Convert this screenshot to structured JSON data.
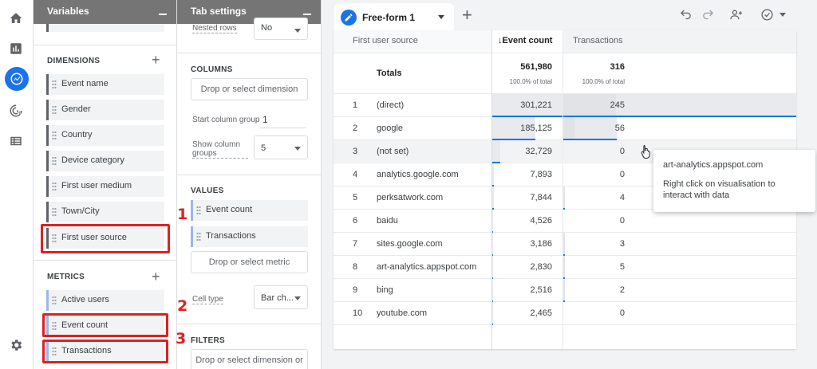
{
  "rail": {
    "icons": [
      "home-icon",
      "reports-icon",
      "explore-icon",
      "advertising-icon",
      "configure-icon",
      "settings-icon"
    ]
  },
  "variables": {
    "title": "Variables",
    "dimensions_label": "DIMENSIONS",
    "dimensions": [
      "Event name",
      "Gender",
      "Country",
      "Device category",
      "First user medium",
      "Town/City",
      "First user source"
    ],
    "metrics_label": "METRICS",
    "metrics": [
      "Active users",
      "Event count",
      "Transactions"
    ]
  },
  "tab_settings": {
    "title": "Tab settings",
    "nested_rows_label": "Nested rows",
    "nested_rows_value": "No",
    "columns_label": "COLUMNS",
    "columns_drop": "Drop or select dimension",
    "start_column_group_label": "Start column group",
    "start_column_group_value": "1",
    "show_column_groups_label": "Show column groups",
    "show_column_groups_value": "5",
    "values_label": "VALUES",
    "values": [
      "Event count",
      "Transactions"
    ],
    "values_drop": "Drop or select metric",
    "cell_type_label": "Cell type",
    "cell_type_value": "Bar ch...",
    "filters_label": "FILTERS",
    "filters_drop": "Drop or select dimension or"
  },
  "annotations": [
    "1",
    "2",
    "3"
  ],
  "tab": {
    "name": "Free-form 1",
    "add": "+"
  },
  "table": {
    "headers": {
      "dimension": "First user source",
      "event_count": "↓Event count",
      "transactions": "Transactions"
    },
    "totals": {
      "label": "Totals",
      "event_count": "561,980",
      "event_count_pct": "100.0% of total",
      "transactions": "316",
      "transactions_pct": "100.0% of total"
    },
    "rows": [
      {
        "n": "1",
        "source": "(direct)",
        "events": "301,221",
        "transactions": "245",
        "events_frac": 1.0,
        "trans_frac": 1.0
      },
      {
        "n": "2",
        "source": "google",
        "events": "185,125",
        "transactions": "56",
        "events_frac": 0.615,
        "trans_frac": 0.229
      },
      {
        "n": "3",
        "source": "(not set)",
        "events": "32,729",
        "transactions": "0",
        "events_frac": 0.109,
        "trans_frac": 0
      },
      {
        "n": "4",
        "source": "analytics.google.com",
        "events": "7,893",
        "transactions": "0",
        "events_frac": 0.026,
        "trans_frac": 0
      },
      {
        "n": "5",
        "source": "perksatwork.com",
        "events": "7,844",
        "transactions": "4",
        "events_frac": 0.026,
        "trans_frac": 0.016
      },
      {
        "n": "6",
        "source": "baidu",
        "events": "4,526",
        "transactions": "0",
        "events_frac": 0.015,
        "trans_frac": 0
      },
      {
        "n": "7",
        "source": "sites.google.com",
        "events": "3,186",
        "transactions": "3",
        "events_frac": 0.011,
        "trans_frac": 0.012
      },
      {
        "n": "8",
        "source": "art-analytics.appspot.com",
        "events": "2,830",
        "transactions": "5",
        "events_frac": 0.009,
        "trans_frac": 0.02
      },
      {
        "n": "9",
        "source": "bing",
        "events": "2,516",
        "transactions": "2",
        "events_frac": 0.008,
        "trans_frac": 0.008
      },
      {
        "n": "10",
        "source": "youtube.com",
        "events": "2,465",
        "transactions": "0",
        "events_frac": 0.008,
        "trans_frac": 0
      }
    ]
  },
  "tooltip": {
    "line1": "art-analytics.appspot.com",
    "line2": "Right click on visualisation to interact with data"
  },
  "colors": {
    "accent": "#1a73e8",
    "highlight": "#e02020",
    "header_gray": "#757575"
  }
}
